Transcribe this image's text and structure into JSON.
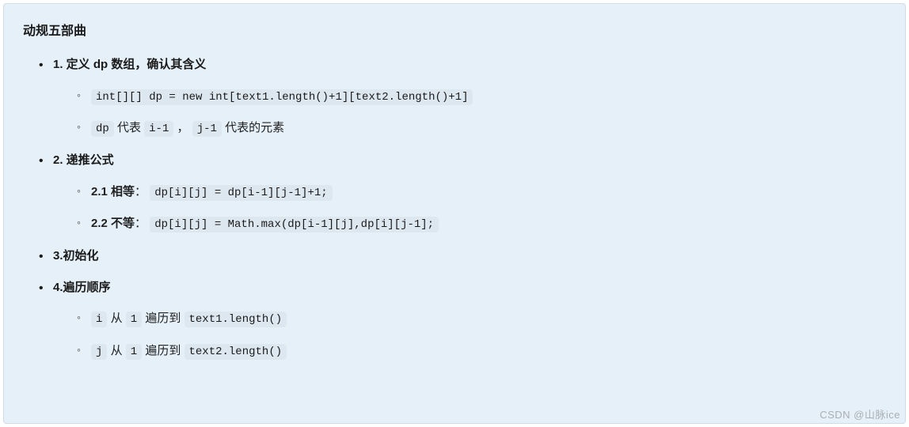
{
  "title": "动规五部曲",
  "section1": {
    "heading": "1. 定义 dp 数组，确认其含义",
    "item1_code": "int[][] dp = new int[text1.length()+1][text2.length()+1]",
    "item2_code1": "dp",
    "item2_text1": " 代表 ",
    "item2_code2": "i-1",
    "item2_text2": " ， ",
    "item2_code3": "j-1",
    "item2_text3": " 代表的元素"
  },
  "section2": {
    "heading": "2. 递推公式",
    "item1_label": "2.1 相等",
    "item1_sep": "：",
    "item1_code": "dp[i][j] = dp[i-1][j-1]+1;",
    "item2_label": "2.2 不等",
    "item2_sep": "：",
    "item2_code": "dp[i][j] = Math.max(dp[i-1][j],dp[i][j-1];"
  },
  "section3": {
    "heading": "3.初始化"
  },
  "section4": {
    "heading": "4.遍历顺序",
    "item1_code1": "i",
    "item1_text1": " 从 ",
    "item1_code2": "1",
    "item1_text2": " 遍历到 ",
    "item1_code3": "text1.length()",
    "item2_code1": "j",
    "item2_text1": " 从 ",
    "item2_code2": "1",
    "item2_text2": " 遍历到 ",
    "item2_code3": "text2.length()"
  },
  "watermark": "CSDN @山脉ice"
}
